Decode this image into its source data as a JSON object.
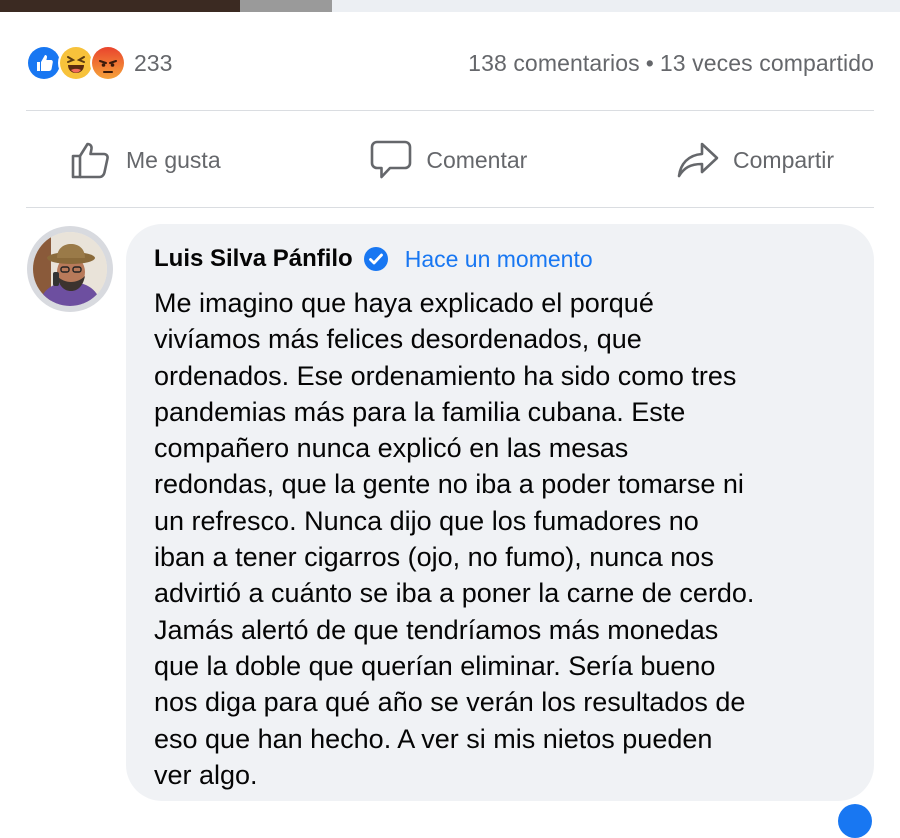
{
  "colors": {
    "accent_blue": "#1877f2",
    "muted_gray": "#65676b",
    "bubble_bg": "#f0f2f5",
    "divider": "#dadde1"
  },
  "reactions": {
    "icons": [
      "like-reaction-icon",
      "haha-reaction-icon",
      "angry-reaction-icon"
    ],
    "count": "233"
  },
  "stats": {
    "comments": "138 comentarios",
    "separator": "•",
    "shares": "13 veces compartido"
  },
  "actions": {
    "like_label": "Me gusta",
    "comment_label": "Comentar",
    "share_label": "Compartir"
  },
  "comment": {
    "author": "Luis Silva Pánfilo",
    "time": "Hace un momento",
    "text": "Me imagino que haya explicado el porqué\nvivíamos más felices  desordenados, que\nordenados. Ese ordenamiento ha sido como tres\npandemias más para la familia cubana. Este\ncompañero nunca explicó en las mesas\nredondas, que la gente no iba a poder tomarse ni\nun refresco. Nunca dijo que los fumadores no\niban a tener cigarros (ojo, no fumo), nunca nos\nadvirtió a cuánto se iba a poner la carne de cerdo.\nJamás alertó de que tendríamos más monedas\nque la doble que querían eliminar. Sería bueno\nnos diga para qué año se verán los resultados de\neso que han hecho.  A ver si mis nietos pueden\nver algo."
  }
}
